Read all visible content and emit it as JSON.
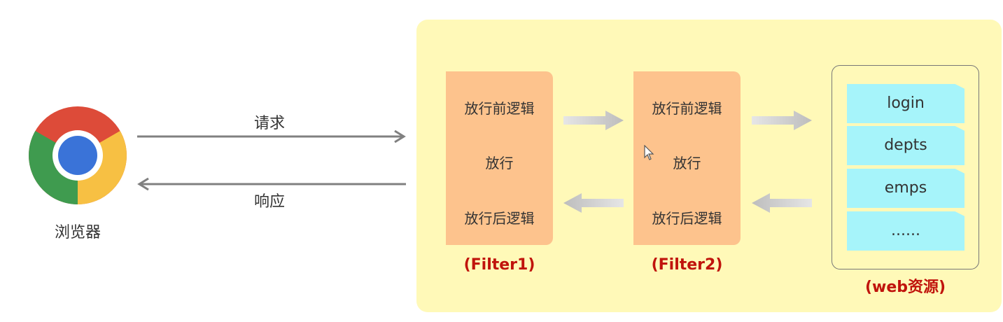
{
  "browser": {
    "label": "浏览器",
    "icon": "chrome-icon"
  },
  "arrows": {
    "request_label": "请求",
    "response_label": "响应"
  },
  "filters": [
    {
      "caption": "(Filter1)",
      "before": "放行前逻辑",
      "pass": "放行",
      "after": "放行后逻辑"
    },
    {
      "caption": "(Filter2)",
      "before": "放行前逻辑",
      "pass": "放行",
      "after": "放行后逻辑"
    }
  ],
  "web": {
    "caption": "(web资源)",
    "items": [
      "login",
      "depts",
      "emps",
      "......"
    ]
  },
  "colors": {
    "panel": "#fff9b8",
    "filter": "#fdc38d",
    "web_item": "#a6f4fa",
    "caption": "#c0140c"
  }
}
